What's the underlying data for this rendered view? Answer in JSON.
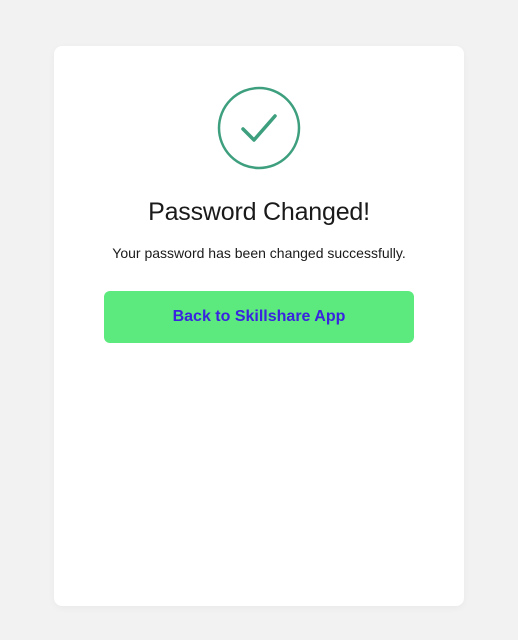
{
  "icon": "checkmark-circle",
  "title": "Password Changed!",
  "subtitle": "Your password has been changed successfully.",
  "button_label": "Back to Skillshare App",
  "colors": {
    "accent_green": "#5cea7e",
    "button_text": "#3a24df",
    "icon_stroke": "#3d9f7e"
  }
}
